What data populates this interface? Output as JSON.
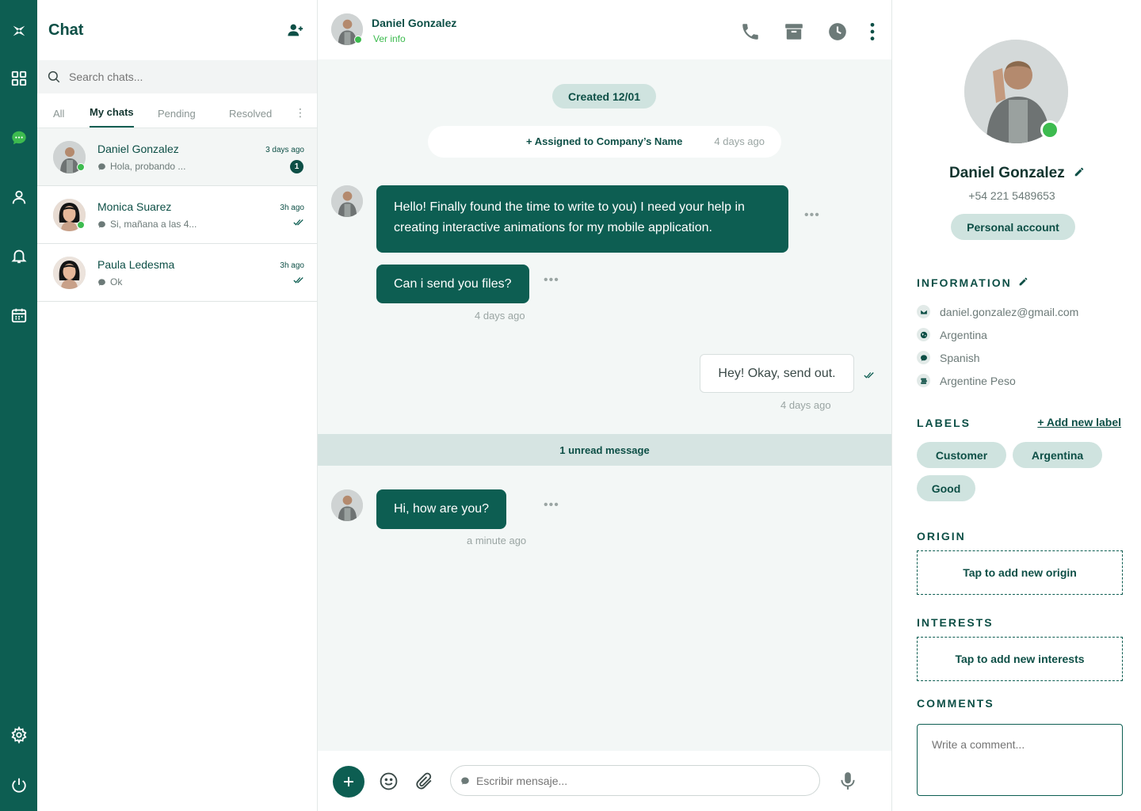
{
  "sidebar": {
    "icons": [
      "logo-icon",
      "grid-icon",
      "chat-icon",
      "user-icon",
      "bell-icon",
      "calendar-icon",
      "settings-icon",
      "power-icon"
    ]
  },
  "chat_list": {
    "title": "Chat",
    "search_placeholder": "Search chats...",
    "tabs": [
      "All",
      "My chats",
      "Pending",
      "Resolved"
    ],
    "active_tab": "My chats",
    "chats": [
      {
        "name": "Daniel Gonzalez",
        "preview": "Hola, probando ...",
        "time": "3 days ago",
        "unread": "1",
        "online": true
      },
      {
        "name": "Monica Suarez",
        "preview": "Si, mañana a las 4...",
        "time": "3h ago",
        "online": true
      },
      {
        "name": "Paula Ledesma",
        "preview": "Ok",
        "time": "3h ago",
        "online": false
      }
    ]
  },
  "conversation": {
    "contact_name": "Daniel Gonzalez",
    "contact_link": "Ver info",
    "created": "Created 12/01",
    "assigned_text": "+ Assigned to Company’s Name",
    "assigned_time": "4 days ago",
    "messages": [
      {
        "text": "Hello! Finally found the time to write to you) I need your help in creating interactive animations for my mobile application."
      },
      {
        "text": "Can i send you files?",
        "time": "4 days ago"
      },
      {
        "text": "Hey! Okay, send out.",
        "time": "4 days ago"
      },
      {
        "text": "Hi, how are you?",
        "time": "a minute ago"
      }
    ],
    "unread_divider": "1 unread message",
    "input_placeholder": "Escribir mensaje..."
  },
  "profile": {
    "name": "Daniel Gonzalez",
    "phone": "+54 221 5489653",
    "account_type": "Personal account",
    "information_title": "INFORMATION",
    "info": [
      {
        "icon": "mail-icon",
        "value": "daniel.gonzalez@gmail.com"
      },
      {
        "icon": "globe-icon",
        "value": "Argentina"
      },
      {
        "icon": "speech-icon",
        "value": "Spanish"
      },
      {
        "icon": "money-icon",
        "value": "Argentine Peso"
      }
    ],
    "labels_title": "LABELS",
    "add_label": "+ Add new label",
    "labels": [
      "Customer",
      "Argentina",
      "Good"
    ],
    "origin_title": "ORIGIN",
    "origin_placeholder": "Tap to add new origin",
    "interests_title": "INTERESTS",
    "interests_placeholder": "Tap to add new interests",
    "comments_title": "COMMENTS",
    "comment_placeholder": "Write a comment..."
  },
  "colors": {
    "primary": "#0d5e52",
    "accent_light": "#cfe3df",
    "online": "#3dbb4f"
  }
}
